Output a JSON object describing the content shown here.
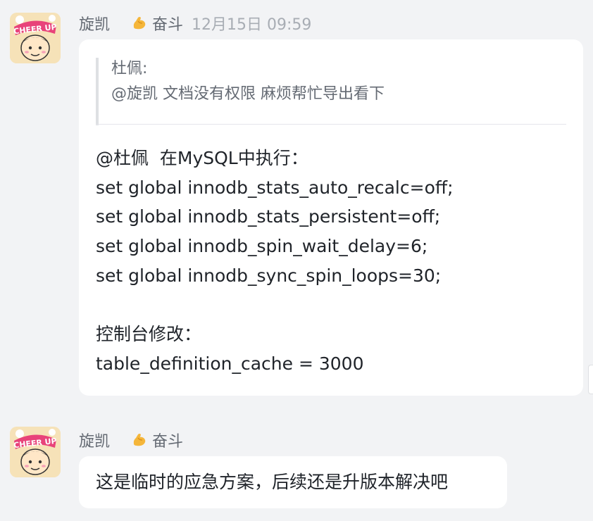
{
  "messages": [
    {
      "sender": "旋凯",
      "status": {
        "icon": "flexed-biceps-icon",
        "text": "奋斗"
      },
      "time": "12月15日 09:59",
      "quote": {
        "author": "杜佩:",
        "text": "@旋凯 文档没有权限 麻烦帮忙导出看下"
      },
      "lines": [
        "@杜佩  在MySQL中执行：",
        "set global innodb_stats_auto_recalc=off;",
        "set global innodb_stats_persistent=off;",
        "set global innodb_spin_wait_delay=6;",
        "set global innodb_sync_spin_loops=30;",
        "",
        "控制台修改：",
        "table_definition_cache = 3000"
      ]
    },
    {
      "sender": "旋凯",
      "status": {
        "icon": "flexed-biceps-icon",
        "text": "奋斗"
      },
      "text": "这是临时的应急方案，后续还是升版本解决吧"
    }
  ],
  "avatar": {
    "text": "CHEER UP",
    "colors": {
      "bg": "#f6e2b8",
      "accent": "#e8437a"
    }
  }
}
